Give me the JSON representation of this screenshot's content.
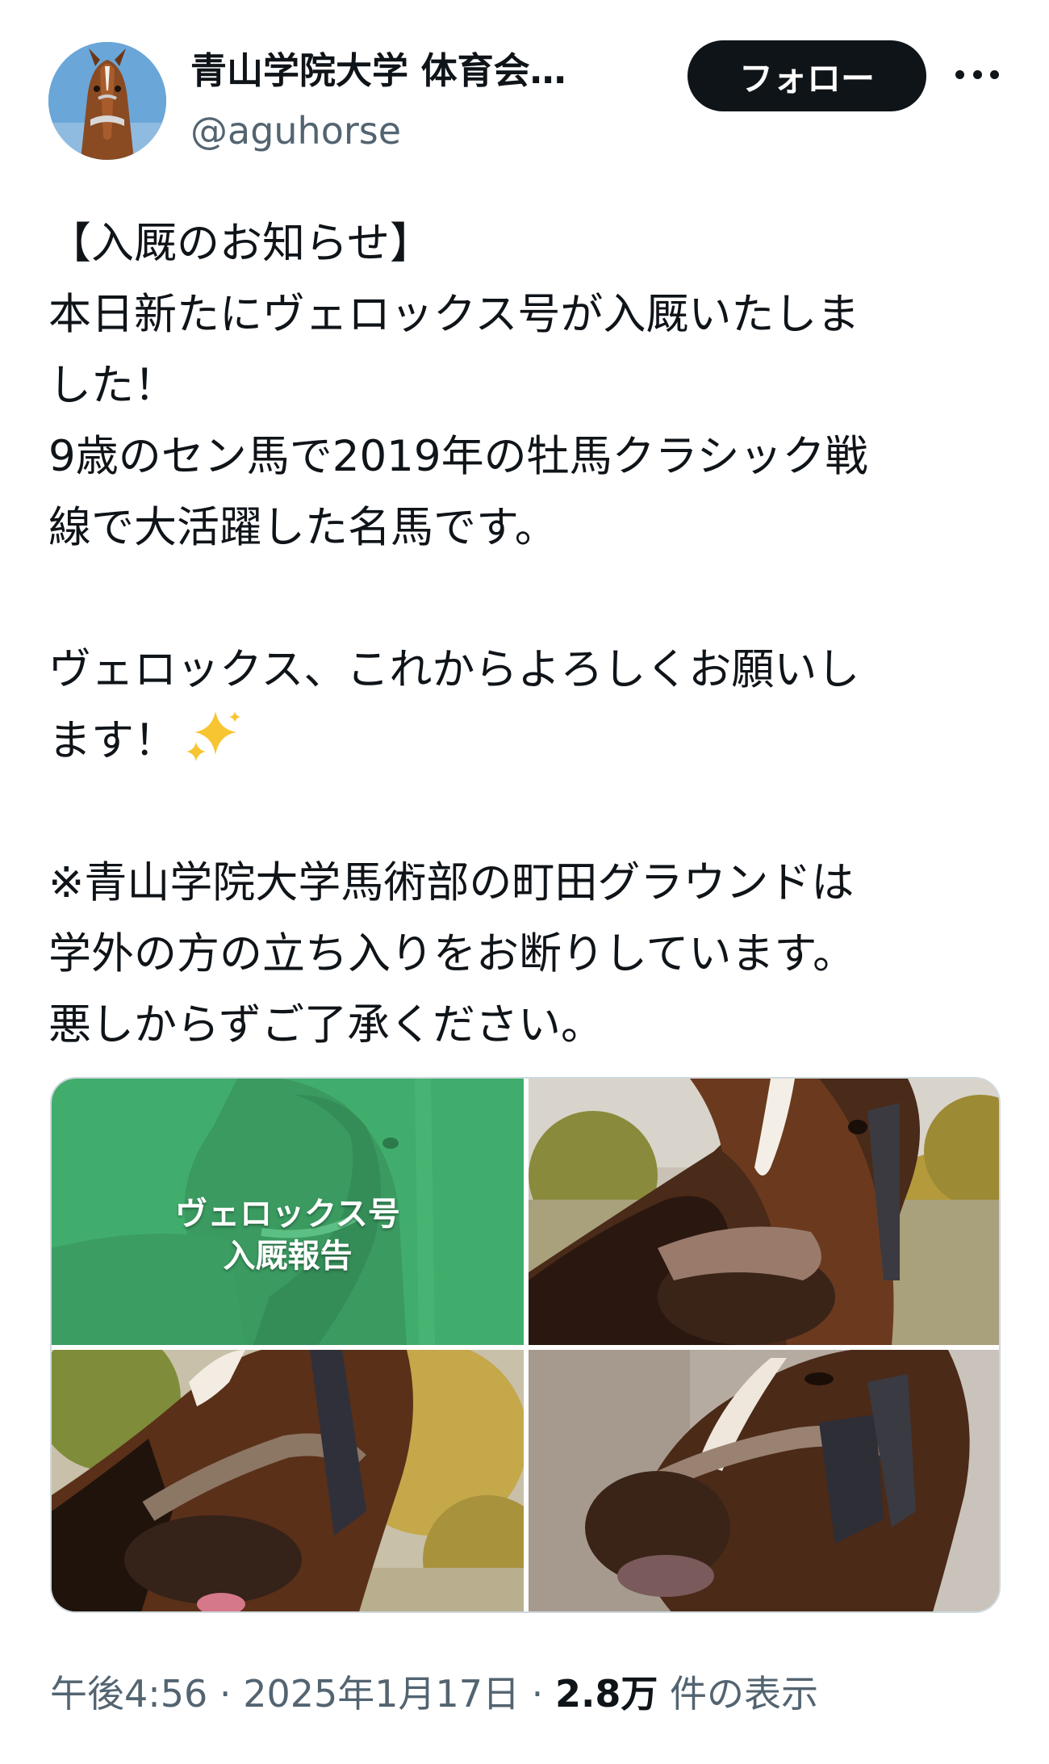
{
  "header": {
    "display_name": "青山学院大学 体育会…",
    "handle": "@aguhorse",
    "follow_label": "フォロー"
  },
  "tweet": {
    "lines": [
      "【入厩のお知らせ】",
      "本日新たにヴェロックス号が入厩いたしま",
      "した！",
      "9歳のセン馬で2019年の牡馬クラシック戦",
      "線で大活躍した名馬です。",
      "ヴェロックス、これからよろしくお願いし",
      "ます！",
      "※青山学院大学馬術部の町田グラウンドは",
      "学外の方の立ち入りをお断りしています。",
      "悪しからずご了承ください。"
    ]
  },
  "media": {
    "cover_line1": "ヴェロックス号",
    "cover_line2": "入厩報告",
    "accent_green": "#3fae6c"
  },
  "meta": {
    "time": "午後4:56",
    "sep1": " · ",
    "date": "2025年1月17日",
    "sep2": " · ",
    "views": "2.8万",
    "views_suffix": " 件の表示"
  },
  "colors": {
    "text": "#0f1419",
    "secondary": "#536471",
    "border": "#cfd9de",
    "button_bg": "#0f1419"
  }
}
